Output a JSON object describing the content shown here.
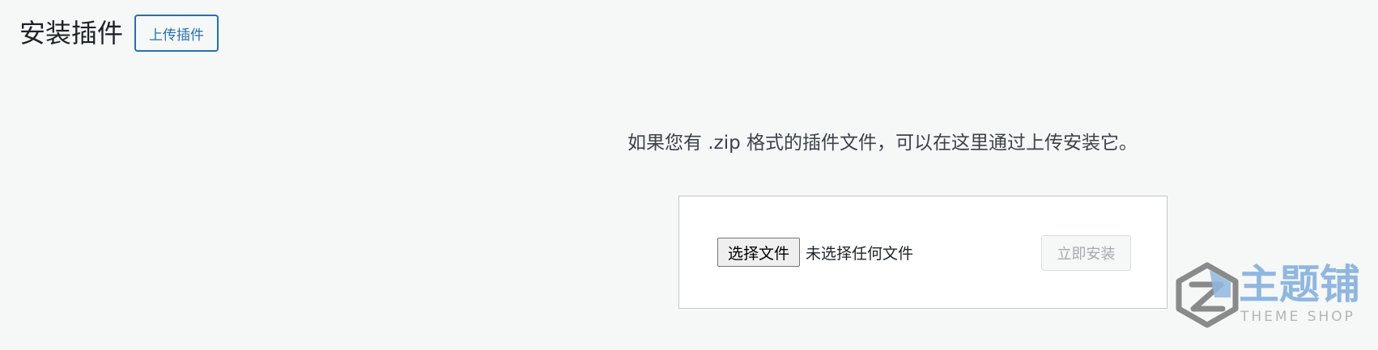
{
  "header": {
    "title": "安装插件",
    "upload_toggle_label": "上传插件"
  },
  "upload": {
    "help_text": "如果您有 .zip 格式的插件文件，可以在这里通过上传安装它。",
    "choose_file_label": "选择文件",
    "file_status": "未选择任何文件",
    "install_label": "立即安装"
  },
  "watermark": {
    "name": "主题铺",
    "subtitle": "THEME SHOP",
    "colors": {
      "name": "#8fb7e0",
      "subtitle": "#b5b5b5",
      "icon_dark": "#8a8a8a",
      "icon_accent": "#8fb7e0"
    }
  },
  "colors": {
    "background": "#f6f7f7",
    "accent": "#2271b1",
    "panel": "#ffffff",
    "disabled_text": "#a7aaad"
  }
}
